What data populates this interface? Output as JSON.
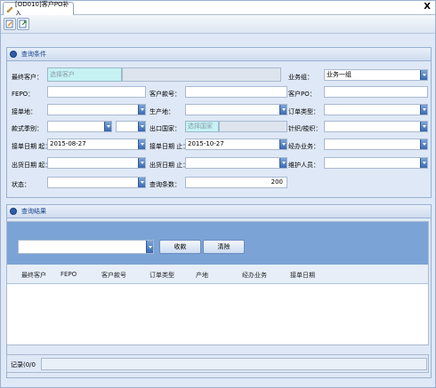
{
  "window": {
    "tab_title": "[OD010]客户PO补入",
    "close_label": "X"
  },
  "toolbar": {
    "icons": [
      "edit-icon",
      "export-icon"
    ]
  },
  "query_panel": {
    "title": "查询条件",
    "fields": {
      "final_customer": {
        "label": "最终客户：",
        "placeholder": "选择客户"
      },
      "business_group": {
        "label": "业务组：",
        "value": "业务一组"
      },
      "fepo": {
        "label": "FEPO："
      },
      "customer_sku": {
        "label": "客户款号："
      },
      "customer_po": {
        "label": "客户PO："
      },
      "order_place": {
        "label": "接单地："
      },
      "production_place": {
        "label": "生产地："
      },
      "order_type": {
        "label": "订单类型："
      },
      "style_type": {
        "label": "款式季别："
      },
      "export_country": {
        "label": "出口国家：",
        "placeholder": "选择国家"
      },
      "knit_woven": {
        "label": "针织/梭织："
      },
      "order_date_from": {
        "label": "接单日期 起：",
        "value": "2015-08-27"
      },
      "order_date_to": {
        "label": "接单日期 止：",
        "value": "2015-10-27"
      },
      "handler": {
        "label": "经办业务："
      },
      "ship_date_from": {
        "label": "出货日期 起："
      },
      "ship_date_to": {
        "label": "出货日期 止："
      },
      "maintainer": {
        "label": "维护人员："
      },
      "status": {
        "label": "状态："
      },
      "query_count": {
        "label": "查询条数：",
        "value": "200"
      }
    }
  },
  "result_panel": {
    "title": "查询结果",
    "collect_button": "收款",
    "clear_button": "清除",
    "columns": [
      "最终客户",
      "FEPO",
      "客户款号",
      "订单类型",
      "产地",
      "经办业务",
      "接单日期"
    ],
    "rows": []
  },
  "footer": {
    "record_label": "记录(0/0"
  },
  "colors": {
    "panel_bg": "#dfe8f6",
    "header_text": "#15428b",
    "toolbar_blue": "#7ba3d5",
    "cyan_field": "#c6f2f4"
  }
}
